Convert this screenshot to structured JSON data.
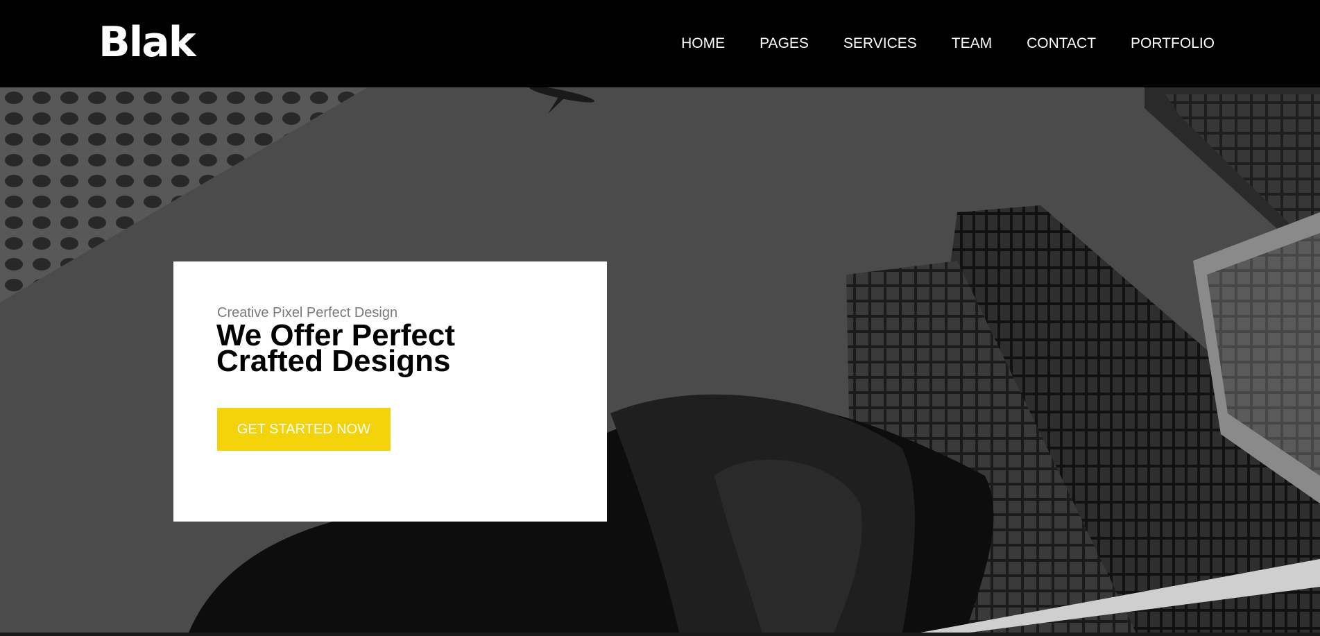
{
  "header": {
    "logo": "Blak",
    "nav": [
      "HOME",
      "PAGES",
      "SERVICES",
      "TEAM",
      "CONTACT",
      "PORTFOLIO"
    ]
  },
  "hero": {
    "subtitle": "Creative Pixel Perfect Design",
    "title_line1": "We Offer Perfect",
    "title_line2": "Crafted Designs",
    "cta_label": "GET STARTED NOW"
  },
  "colors": {
    "header_bg": "#000000",
    "accent": "#f5d30b",
    "card_bg": "#ffffff"
  }
}
